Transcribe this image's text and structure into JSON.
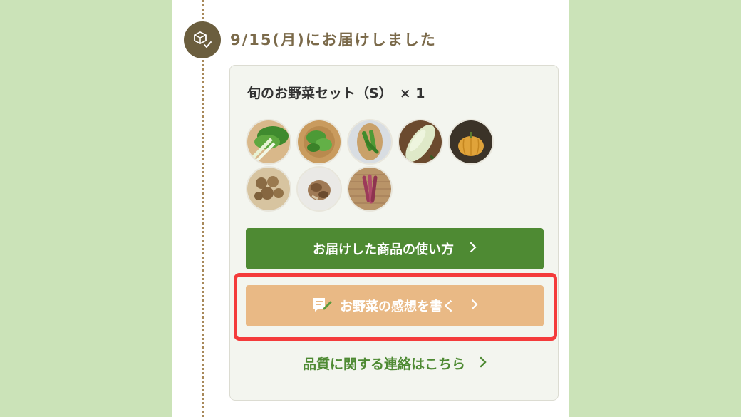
{
  "delivery": {
    "status_text": "9/15(月)にお届けしました",
    "status_icon": "package-check-icon"
  },
  "order": {
    "product_name": "旬のお野菜セット（S）",
    "quantity": "× 1",
    "vegetables": [
      {
        "name": "komatsuna"
      },
      {
        "name": "leafy-greens"
      },
      {
        "name": "okra"
      },
      {
        "name": "white-eggplant"
      },
      {
        "name": "pumpkin"
      },
      {
        "name": "potatoes"
      },
      {
        "name": "mushrooms"
      },
      {
        "name": "myoga"
      }
    ]
  },
  "buttons": {
    "usage_label": "お届けした商品の使い方",
    "review_label": "お野菜の感想を書く",
    "contact_label": "品質に関する連絡はこちら"
  },
  "colors": {
    "background": "#cbe3b8",
    "primary_green": "#4e8a33",
    "review_button": "#e9b985",
    "highlight": "#f43b3b",
    "status_icon_bg": "#6b5e3e"
  }
}
